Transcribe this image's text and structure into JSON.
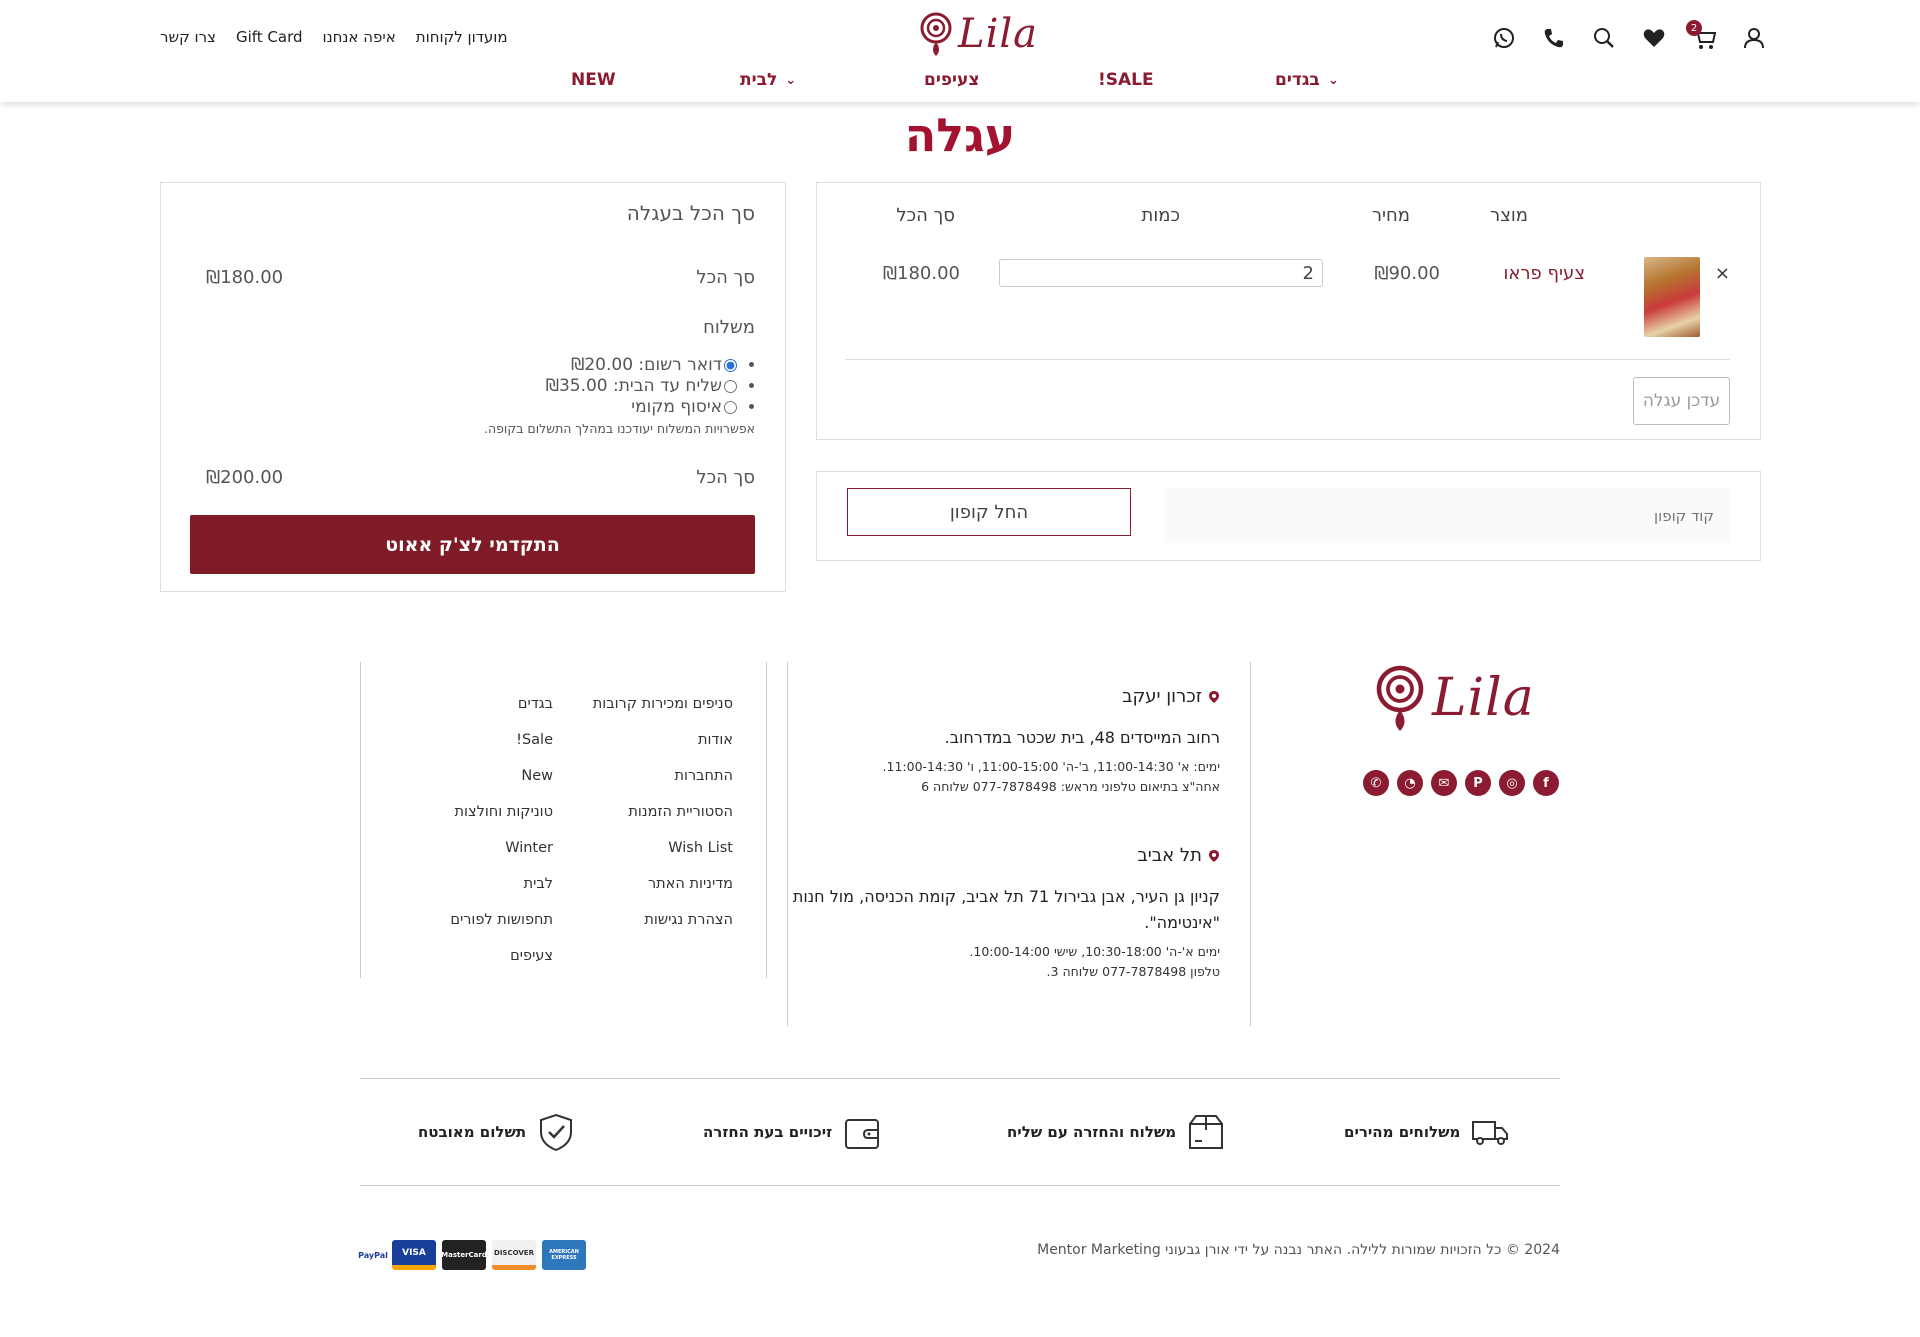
{
  "header": {
    "top_links": [
      "צרו קשר",
      "Gift Card",
      "איפה אנחנו",
      "מועדון לקוחות"
    ],
    "logo_text": "Lila",
    "cart_count": "2",
    "nav": [
      {
        "label": "בגדים",
        "has_dropdown": true
      },
      {
        "label": "SALE!",
        "has_dropdown": false
      },
      {
        "label": "צעיפים",
        "has_dropdown": false
      },
      {
        "label": "לבית",
        "has_dropdown": true
      },
      {
        "label": "NEW",
        "has_dropdown": false
      }
    ],
    "icons": [
      "whatsapp-icon",
      "phone-icon",
      "search-icon",
      "heart-icon",
      "cart-icon",
      "user-icon"
    ]
  },
  "page": {
    "title": "עגלה"
  },
  "cart": {
    "headers": {
      "product": "מוצר",
      "price": "מחיר",
      "quantity": "כמות",
      "subtotal": "סך הכל"
    },
    "items": [
      {
        "remove": "×",
        "name": "צעיף פראו",
        "price": "₪90.00",
        "quantity": "2",
        "subtotal": "₪180.00"
      }
    ],
    "update_button": "עדכן עגלה"
  },
  "coupon": {
    "placeholder": "קוד קופון",
    "button": "החל קופון"
  },
  "totals": {
    "title": "סך הכל בעגלה",
    "subtotal_label": "סך הכל",
    "subtotal_value": "₪180.00",
    "shipping_label": "משלוח",
    "shipping_options": [
      {
        "label": "דואר רשום: ",
        "price": "₪20.00",
        "selected": true
      },
      {
        "label": "שליח עד הבית: ",
        "price": "₪35.00",
        "selected": false
      },
      {
        "label": "איסוף מקומי",
        "price": "",
        "selected": false
      }
    ],
    "shipping_note": "אפשרויות המשלוח יעודכנו במהלך התשלום בקופה.",
    "total_label": "סך הכל",
    "total_value": "₪200.00",
    "checkout_button": "התקדמי לצ'ק אאוט"
  },
  "footer": {
    "logo_text": "Lila",
    "social": [
      "facebook-icon",
      "instagram-icon",
      "pinterest-icon",
      "email-icon",
      "whatsapp-icon",
      "phone-icon"
    ],
    "branches": [
      {
        "name": "זכרון יעקב",
        "address": "רחוב המייסדים 48, בית שכטר במדרחוב.",
        "hours": "ימים: א' 11:00-14:30, ב'-ה' 11:00-15:00, ו' 11:00-14:30.",
        "extra": "אחה\"צ בתיאום טלפוני מראש: 077-7878498 שלוחה 6"
      },
      {
        "name": "תל אביב",
        "address": "קניון גן העיר, אבן גבירול 71 תל אביב, קומת הכניסה, מול חנות \"אינטימה\".",
        "hours": "ימים א'-ה' 10:30-18:00, שישי 10:00-14:00.",
        "extra": "טלפון 077-7878498 שלוחה 3."
      }
    ],
    "links_col1": [
      "סניפים ומכירות קרובות",
      "אודות",
      "התחברות",
      "הסטוריית הזמנות",
      "Wish List",
      "מדיניות האתר",
      "הצהרת נגישות"
    ],
    "links_col2": [
      "בגדים",
      "Sale!",
      "New",
      "טוניקות וחולצות",
      "Winter",
      "לבית",
      "תחפושות לפורים",
      "צעיפים"
    ],
    "features": [
      {
        "label": "משלוחים מהירים",
        "icon": "truck-icon"
      },
      {
        "label": "משלוח והחזרה עם שליח",
        "icon": "box-icon"
      },
      {
        "label": "זיכויים בעת החזרה",
        "icon": "wallet-icon"
      },
      {
        "label": "תשלום מאובטח",
        "icon": "shield-check-icon"
      }
    ],
    "copyright": "2024 © כל הזכויות שמורות ללילה. האתר נבנה על ידי אורן גבעוני Mentor Marketing",
    "payments": [
      "AMERICAN EXPRESS",
      "DISCOVER",
      "MasterCard",
      "VISA",
      "PayPal"
    ]
  },
  "colors": {
    "brand": "#8a1b30",
    "title": "#a3122f",
    "checkout": "#7f1b27"
  }
}
